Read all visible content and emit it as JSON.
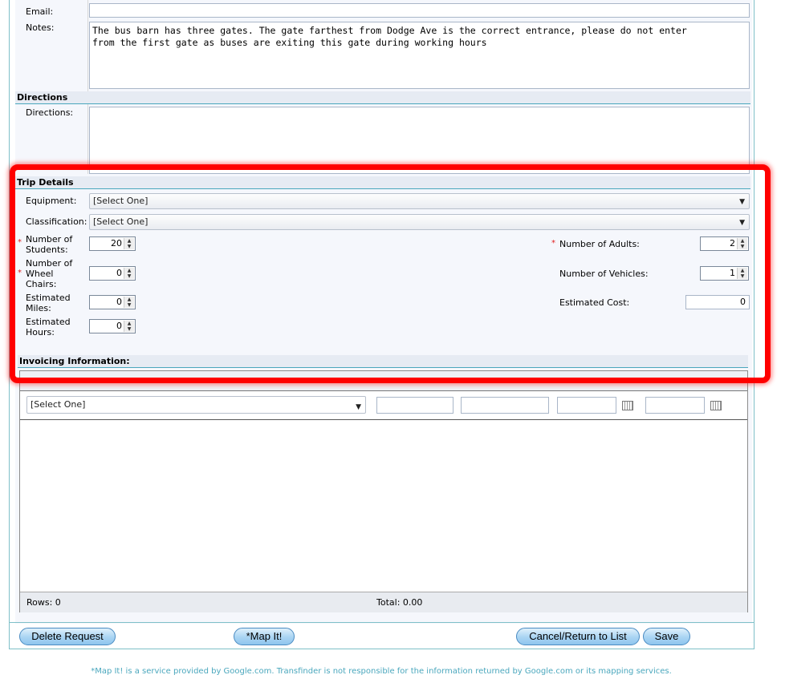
{
  "form": {
    "email_label": "Email:",
    "email_value": "",
    "notes_label": "Notes:",
    "notes_value": "The bus barn has three gates. The gate farthest from Dodge Ave is the correct entrance, please do not enter\nfrom the first gate as buses are exiting this gate during working hours",
    "directions_section": "Directions",
    "directions_label": "Directions:",
    "directions_value": ""
  },
  "trip": {
    "section_title": "Trip Details",
    "equipment_label": "Equipment:",
    "equipment_value": "[Select One]",
    "classification_label": "Classification:",
    "classification_value": "[Select One]",
    "students_label_1": "Number of",
    "students_label_2": "Students:",
    "students_value": "20",
    "wheelchairs_label_1": "Number of",
    "wheelchairs_label_2": "Wheel",
    "wheelchairs_label_3": "Chairs:",
    "wheelchairs_value": "0",
    "miles_label_1": "Estimated",
    "miles_label_2": "Miles:",
    "miles_value": "0",
    "hours_label_1": "Estimated",
    "hours_label_2": "Hours:",
    "hours_value": "0",
    "adults_label": "Number of Adults:",
    "adults_value": "2",
    "vehicles_label": "Number of Vehicles:",
    "vehicles_value": "1",
    "cost_label": "Estimated Cost:",
    "cost_value": "0",
    "required_mark": "*"
  },
  "invoicing": {
    "section_title": "Invoicing Information:",
    "account_select": "[Select One]",
    "rows_label": "Rows: 0",
    "total_label": "Total: 0.00"
  },
  "buttons": {
    "delete": "Delete Request",
    "map": "*Map It!",
    "cancel": "Cancel/Return to List",
    "save": "Save"
  },
  "footnote": "*Map It! is a service provided by Google.com.  Transfinder is not responsible for the information returned by Google.com or its mapping services.",
  "colors": {
    "accent": "#4aa7bd",
    "highlight": "#ff0000",
    "button": "#a9d4f3"
  }
}
